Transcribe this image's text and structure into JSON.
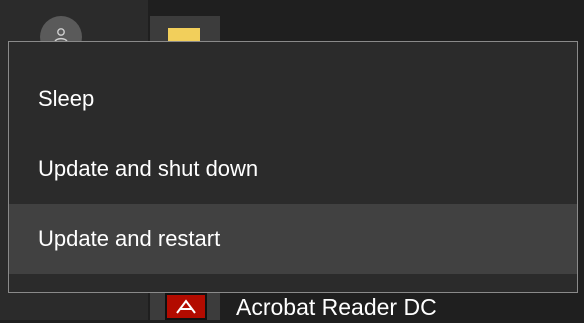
{
  "start_menu": {
    "app_label": "Acrobat Reader DC"
  },
  "power_menu": {
    "items": [
      {
        "label": "Sleep"
      },
      {
        "label": "Update and shut down"
      },
      {
        "label": "Update and restart",
        "highlighted": true
      }
    ]
  },
  "icons": {
    "avatar": "user-icon",
    "folder": "folder-icon",
    "acrobat": "acrobat-reader-icon"
  },
  "colors": {
    "menu_background": "#2b2b2b",
    "menu_highlight": "#414141",
    "menu_border": "#8a8a8a",
    "folder": "#f2cf5b",
    "acrobat": "#b30b00"
  }
}
